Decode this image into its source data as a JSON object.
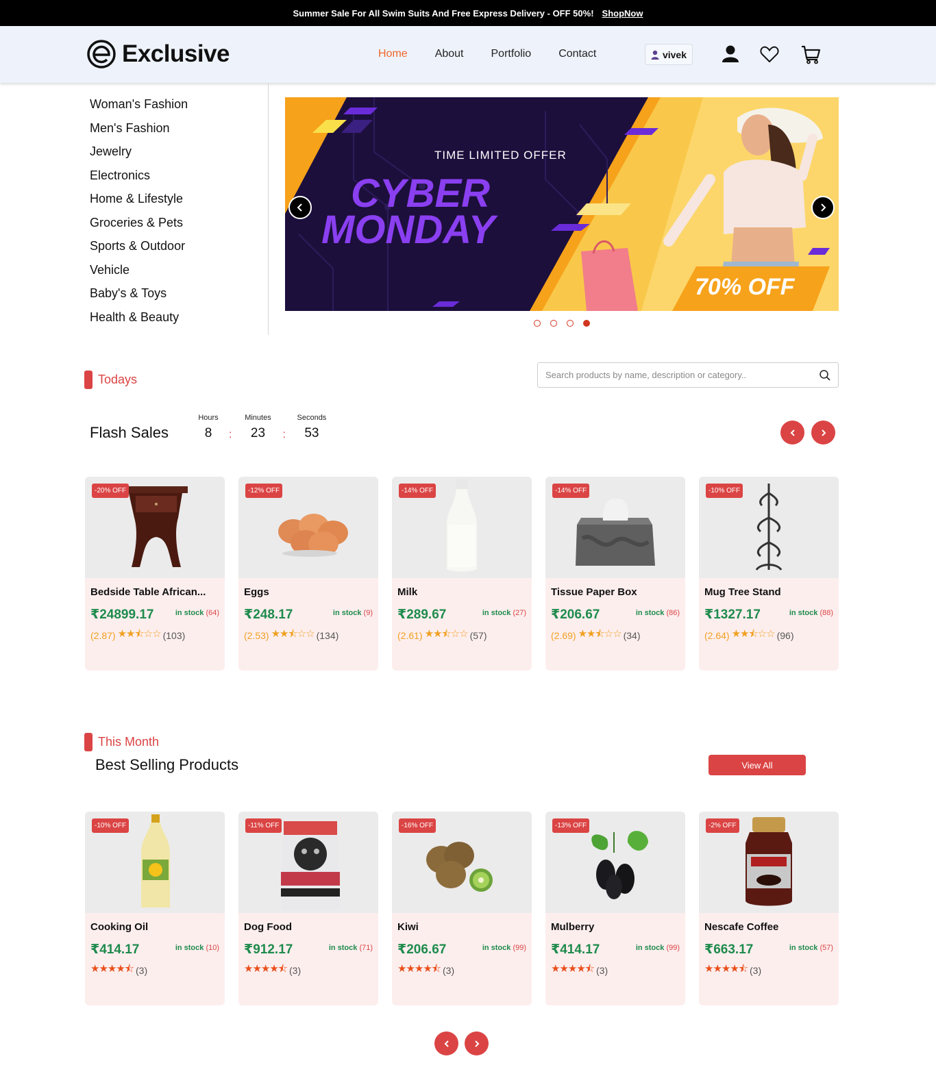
{
  "topbar": {
    "text": "Summer Sale For All Swim Suits And Free Express Delivery - OFF 50%!",
    "link": "ShopNow"
  },
  "header": {
    "logo": "Exclusive",
    "nav": [
      "Home",
      "About",
      "Portfolio",
      "Contact"
    ],
    "active_nav": "Home",
    "user": "vivek"
  },
  "sidebar": [
    "Woman's Fashion",
    "Men's Fashion",
    "Jewelry",
    "Electronics",
    "Home & Lifestyle",
    "Groceries & Pets",
    "Sports & Outdoor",
    "Vehicle",
    "Baby's & Toys",
    "Health & Beauty"
  ],
  "hero": {
    "kicker": "TIME LIMITED OFFER",
    "line1": "CYBER",
    "line2": "MONDAY",
    "offer": "70% OFF",
    "active_slide": 4,
    "slides": 4
  },
  "todays": {
    "tag": "Todays",
    "title": "Flash Sales",
    "search_placeholder": "Search products by name, description or category..",
    "timer": {
      "hours_label": "Hours",
      "minutes_label": "Minutes",
      "seconds_label": "Seconds",
      "hours": "8",
      "minutes": "23",
      "seconds": "53",
      "sep": ":"
    },
    "products": [
      {
        "badge": "-20% OFF",
        "name": "Bedside Table African...",
        "price": "₹24899.17",
        "stock_label": "in stock",
        "stock": "(64)",
        "rating": "(2.87)",
        "stars": "★★⯪☆☆",
        "reviews": "(103)",
        "icon": "table"
      },
      {
        "badge": "-12% OFF",
        "name": "Eggs",
        "price": "₹248.17",
        "stock_label": "in stock",
        "stock": "(9)",
        "rating": "(2.53)",
        "stars": "★★⯪☆☆",
        "reviews": "(134)",
        "icon": "eggs"
      },
      {
        "badge": "-14% OFF",
        "name": "Milk",
        "price": "₹289.67",
        "stock_label": "in stock",
        "stock": "(27)",
        "rating": "(2.61)",
        "stars": "★★⯪☆☆",
        "reviews": "(57)",
        "icon": "milk"
      },
      {
        "badge": "-14% OFF",
        "name": "Tissue Paper Box",
        "price": "₹206.67",
        "stock_label": "in stock",
        "stock": "(86)",
        "rating": "(2.69)",
        "stars": "★★⯪☆☆",
        "reviews": "(34)",
        "icon": "tissue"
      },
      {
        "badge": "-10% OFF",
        "name": "Mug Tree Stand",
        "price": "₹1327.17",
        "stock_label": "in stock",
        "stock": "(88)",
        "rating": "(2.64)",
        "stars": "★★⯪☆☆",
        "reviews": "(96)",
        "icon": "mugtree"
      }
    ]
  },
  "month": {
    "tag": "This Month",
    "title": "Best Selling Products",
    "view_all": "View All",
    "products": [
      {
        "badge": "-10% OFF",
        "name": "Cooking Oil",
        "price": "₹414.17",
        "stock_label": "in stock",
        "stock": "(10)",
        "stars": "★★★★⯪",
        "reviews": "(3)",
        "icon": "oil"
      },
      {
        "badge": "-11% OFF",
        "name": "Dog Food",
        "price": "₹912.17",
        "stock_label": "in stock",
        "stock": "(71)",
        "stars": "★★★★⯪",
        "reviews": "(3)",
        "icon": "dogfood"
      },
      {
        "badge": "-16% OFF",
        "name": "Kiwi",
        "price": "₹206.67",
        "stock_label": "in stock",
        "stock": "(99)",
        "stars": "★★★★⯪",
        "reviews": "(3)",
        "icon": "kiwi"
      },
      {
        "badge": "-13% OFF",
        "name": "Mulberry",
        "price": "₹414.17",
        "stock_label": "in stock",
        "stock": "(99)",
        "stars": "★★★★⯪",
        "reviews": "(3)",
        "icon": "mulberry"
      },
      {
        "badge": "-2% OFF",
        "name": "Nescafe Coffee",
        "price": "₹663.17",
        "stock_label": "in stock",
        "stock": "(57)",
        "stars": "★★★★⯪",
        "reviews": "(3)",
        "icon": "coffee"
      }
    ]
  },
  "colors": {
    "accent": "#db4444",
    "nav_active": "#f0662a",
    "price": "#1e8b4c",
    "star": "#f0a020"
  }
}
